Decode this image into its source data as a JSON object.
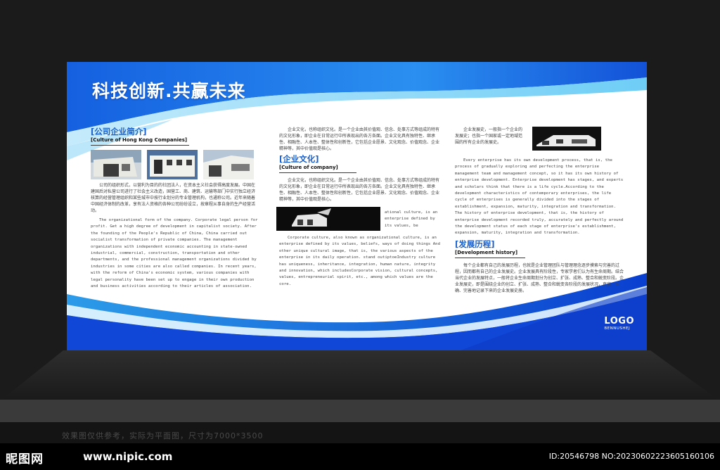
{
  "board": {
    "headline": "科技创新.共赢未来",
    "col1": {
      "title": "[公司企业简介]",
      "subtitle": "[Culture of Hong Kong Companies]",
      "zh": "公司的组织形式，以营利为目的的社团法人，在资本主义社会获得高度发展。中国在建国后对私营公司进行了社会主义改造，国营工、商、建筑、运输等部门中实行独立经济核算的经营管理组织和某些城市中按行业划分的专业管理机构，也通称公司。近年来随着中国经济体制的改革，享有法人资格的各种公司纷纷设立，按章程从事自身的生产经营活动。",
      "en": "The organizational form of the company. Corporate legal person for profit. Get a high degree of development in capitalist society. After the founding of the People's Republic of China, China carried out socialist transformation of private companies. The management organizations with independent economic accounting in state-owned industrial, commercial, construction, transportation and other departments, and the professional management organizations divided by industries in some cities are also called companies. In recent years, with the reform of China's economic system, various companies with legal personality have been set up to engage in their own production and business activities according to their articles of association."
    },
    "col2": {
      "zh_top": "企业文化，也称组织文化。是一个企业由其价值观、信念、处事方式等组成的特有的文化形象，即企业在日常运行中所表现出的各方各面。企业文化具有独特性、继承性、相融性、人本性、整体性和创新性，它包括企业愿景、文化观念、价值观念、企业精神等，其中价值观是核心。",
      "title": "[企业文化]",
      "subtitle": "[Culture of company]",
      "zh": "企业文化，也称组织文化。是一个企业由其价值观、信念、处事方式等组成的特有的文化形象，即企业在日常运行中所表现出的各方各面。企业文化具有独特性、继承性、相融性、人本性、整体性和创新性，它包括企业愿景、文化观念、价值观念、企业精神等，其中价值观是核心。",
      "en_beside": "ational culture, is an enterprise defined by its values, be",
      "en": "Corporate culture, also known as organizational culture, is an enterprise defined by its values, beliefs, ways of doing things And other unique cultural image, that is, the various aspects of the enterprise in its daily operation. stand outiptoeIndustry culture has uniqueness, inheritance, integration, human nature, integrity and innovation, which includesCorporate vision, cultural concepts, values, entrepreneurial spirit, etc., among which values are the core."
    },
    "col3": {
      "zh_top": "企业发展史，一般指一个企业的发展史；也指一个国家或一定地域范围的所有企业的发展史。",
      "en": "Every enterprise has its own development process, that is, the process of gradually exploring and perfecting the enterprise management team and management concept, so it has its own history of enterprise development. Enterprise development has stages, and experts and scholars think that there is a life cycle.According to the development characteristics of contemporary enterprises, the life cycle of enterprises is generally divided into the stages of establishment, expansion, maturity, integration and transformation. The history of enterprise development, that is, the history of enterprise development recorded truly, accurately and perfectly around the development status of each stage of enterprise's establishment, expansion, maturity, integration and transformation.",
      "title": "[发展历程]",
      "subtitle": "[Development history]",
      "zh": "每个企业都有自己的发展历程，也就是企业管理团队与管理理念逐步摸索与完善的过程，因而都有自己的企业发展史。企业发展具有阶段性，专家学者们认为有生命周期。结合当代企业的发展特点，一般将企业生命周期划分为创立、扩张、成熟、整合和蜕变阶段。企业发展史，即是围绕企业的创立、扩张、成熟、整合和蜕变各阶段的发展状况，真实、准确、完善地记录下来的企业发展史册。"
    },
    "logo": {
      "main": "LOGO",
      "sub": "BENNUSHEJ"
    }
  },
  "caption": "效果图仅供参考，实际为平面图，尺寸为7000*3500",
  "watermark": {
    "site_name": "昵图网",
    "url": "www.nipic.com",
    "id_text": "ID:20546798 NO:20230602223605160106"
  },
  "colors": {
    "accent": "#1a5fc9",
    "blue_deep": "#0d4fd6",
    "blue_light": "#5fc3f5"
  }
}
